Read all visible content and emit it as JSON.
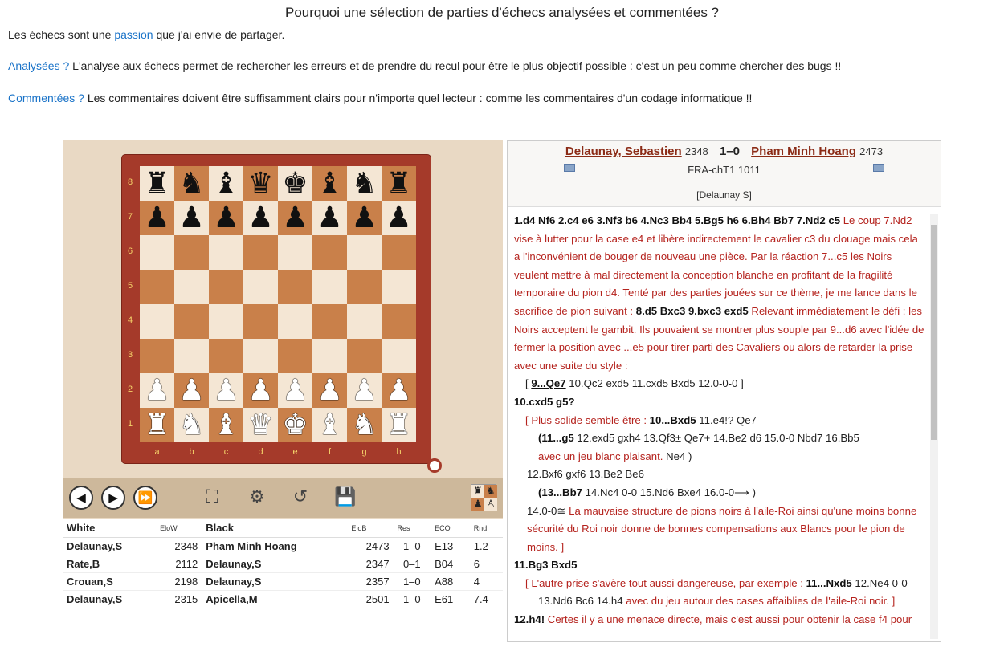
{
  "page": {
    "title": "Pourquoi une sélection de parties d'échecs analysées et commentées ?",
    "p1_before": "Les échecs sont une ",
    "p1_link": "passion",
    "p1_after": " que j'ai envie de partager.",
    "p2_link": "Analysées ?",
    "p2_text": " L'analyse aux échecs permet de rechercher les erreurs et de prendre du recul pour être le plus objectif possible : c'est un peu comme chercher des bugs !!",
    "p3_link": "Commentées ?",
    "p3_text": " Les commentaires doivent être suffisamment clairs pour n'importe quel lecteur : comme les commentaires d'un codage informatique !!"
  },
  "board": {
    "ranks": [
      "8",
      "7",
      "6",
      "5",
      "4",
      "3",
      "2",
      "1"
    ],
    "files": [
      "a",
      "b",
      "c",
      "d",
      "e",
      "f",
      "g",
      "h"
    ],
    "position": [
      [
        "bR",
        "bN",
        "bB",
        "bQ",
        "bK",
        "bB",
        "bN",
        "bR"
      ],
      [
        "bP",
        "bP",
        "bP",
        "bP",
        "bP",
        "bP",
        "bP",
        "bP"
      ],
      [
        "",
        "",
        "",
        "",
        "",
        "",
        "",
        ""
      ],
      [
        "",
        "",
        "",
        "",
        "",
        "",
        "",
        ""
      ],
      [
        "",
        "",
        "",
        "",
        "",
        "",
        "",
        ""
      ],
      [
        "",
        "",
        "",
        "",
        "",
        "",
        "",
        ""
      ],
      [
        "wP",
        "wP",
        "wP",
        "wP",
        "wP",
        "wP",
        "wP",
        "wP"
      ],
      [
        "wR",
        "wN",
        "wB",
        "wQ",
        "wK",
        "wB",
        "wN",
        "wR"
      ]
    ]
  },
  "controls": {
    "back": "back-arrow-icon",
    "forward": "forward-arrow-icon",
    "end": "fast-forward-icon",
    "fullscreen": "fullscreen-icon",
    "autoplay": "autoplay-icon",
    "rotate": "rotate-icon",
    "save": "save-icon"
  },
  "games": {
    "headers": [
      "White",
      "EloW",
      "Black",
      "EloB",
      "Res",
      "ECO",
      "Rnd"
    ],
    "rows": [
      {
        "white": "Delaunay,S",
        "elow": "2348",
        "black": "Pham Minh Hoang",
        "elob": "2473",
        "res": "1–0",
        "eco": "E13",
        "rnd": "1.2"
      },
      {
        "white": "Rate,B",
        "elow": "2112",
        "black": "Delaunay,S",
        "elob": "2347",
        "res": "0–1",
        "eco": "B04",
        "rnd": "6"
      },
      {
        "white": "Crouan,S",
        "elow": "2198",
        "black": "Delaunay,S",
        "elob": "2357",
        "res": "1–0",
        "eco": "A88",
        "rnd": "4"
      },
      {
        "white": "Delaunay,S",
        "elow": "2315",
        "black": "Apicella,M",
        "elob": "2501",
        "res": "1–0",
        "eco": "E61",
        "rnd": "7.4"
      }
    ]
  },
  "game_header": {
    "white": "Delaunay, Sebastien",
    "white_elo": "2348",
    "result": "1–0",
    "black": "Pham Minh Hoang",
    "black_elo": "2473",
    "event": "FRA-chT1 1011",
    "annotator": "[Delaunay S]"
  },
  "moves": {
    "m1": "1.d4 Nf6 2.c4 e6 3.Nf3 b6 4.Nc3 Bb4 5.Bg5 h6 6.Bh4 Bb7 7.Nd2 c5",
    "c1": " Le coup 7.Nd2 vise à lutter pour la case e4 et libère indirectement le cavalier c3 du clouage mais cela a l'inconvénient de bouger de nouveau une pièce. Par la réaction 7...c5 les Noirs veulent mettre à mal directement la conception blanche en profitant de la fragilité temporaire du pion d4. Tenté par des parties jouées sur ce thème, je me lance dans le sacrifice de pion suivant : ",
    "m2": "8.d5 Bxc3 9.bxc3 exd5",
    "c2": " Relevant immédiatement le défi : les Noirs acceptent le gambit. Ils pouvaient se montrer plus souple par 9...d6 avec l'idée de fermer la position avec ...e5 pour tirer parti des Cavaliers ou alors de retarder la prise avec une suite du style :",
    "v1a": "[ ",
    "v1b": "9...Qe7",
    "v1c": " 10.Qc2 exd5 11.cxd5 Bxd5 12.0-0-0 ]",
    "m3": "10.cxd5 g5?",
    "v2a": "[ Plus solide semble être : ",
    "v2b": "10...Bxd5",
    "v2c": " 11.e4!? Qe7",
    "v3a": "(11...g5",
    "v3b": " 12.exd5 gxh4 13.Qf3± Qe7+ 14.Be2 d6 15.0-0 Nbd7 16.Bb5",
    "v3c": "avec un jeu blanc plaisant.",
    "v3d": " Ne4 )",
    "v4": "12.Bxf6 gxf6 13.Be2 Be6",
    "v5a": "(13...Bb7",
    "v5b": " 14.Nc4 0-0 15.Nd6 Bxe4 16.0-0⟶ )",
    "v6a": "14.0-0",
    "v6b": "≅",
    "v6c": " La mauvaise structure de pions noirs à l'aile-Roi ainsi qu'une moins bonne sécurité du Roi noir donne de bonnes compensations aux Blancs pour le pion de moins. ]",
    "m4": "11.Bg3 Bxd5",
    "v7a": "[ L'autre prise s'avère tout aussi dangereuse, par exemple : ",
    "v7b": "11...Nxd5",
    "v7c": " 12.Ne4 0-0",
    "v8a": "13.Nd6 Bc6 14.h4",
    "v8b": " avec du jeu autour des cases affaiblies de l'aile-Roi noir. ]",
    "m5": "12.h4!",
    "c5": " Certes il y a une menace directe, mais c'est aussi pour obtenir la case f4 pour"
  }
}
